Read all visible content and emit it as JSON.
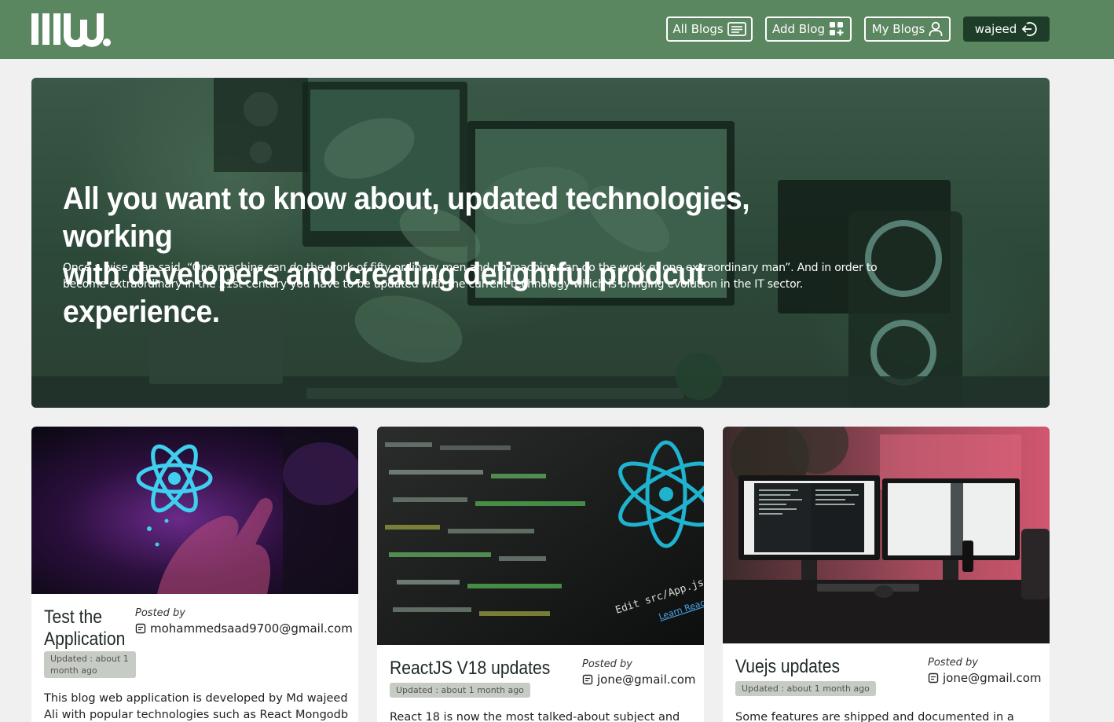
{
  "header": {
    "nav": {
      "all_blogs": "All Blogs",
      "add_blog": "Add Blog",
      "my_blogs": "My Blogs",
      "user": "wajeed"
    }
  },
  "hero": {
    "title_line1": "All you want to know about, updated technologies, working",
    "title_line2": "with developers and creating delightful prodcut experience.",
    "text": "Once a wise man said, “One machine can do the work of fifty ordinary men and no machine can do the work of one extraordinary man”. And in order to become extraordinary in the 21st century you have to be updated with the current technology which is bringing evolution in the IT sector."
  },
  "cards": [
    {
      "title_line1": "Test the",
      "title_line2": "Application",
      "posted_label": "Posted by",
      "email": "mohammedsaad9700@gmail.com",
      "updated_line1": "Updated : about 1",
      "updated_line2": "month ago",
      "desc": "This blog web application is developed by Md wajeed Ali with popular technologies such as React Mongodb"
    },
    {
      "title": "ReactJS V18 updates",
      "posted_label": "Posted by",
      "email": "jone@gmail.com",
      "updated": "Updated : about 1 month ago",
      "desc": "React 18 is now the most talked-about subject and",
      "image_text_1": "Edit src/App.js and save to",
      "image_text_2": "Learn React"
    },
    {
      "title": "Vuejs updates",
      "posted_label": "Posted by",
      "email": "jone@gmail.com",
      "updated": "Updated : about 1 month ago",
      "desc": "Some features are shipped and documented in a"
    }
  ],
  "colors": {
    "header_bg": "#5a8660",
    "user_button_bg": "#1e3d28",
    "page_bg": "#f0f0f1",
    "badge_bg": "#c6cbc3",
    "react_cyan": "#3fd0f0"
  },
  "icons": {
    "all_blogs": "list-icon",
    "add_blog": "grid-plus-icon",
    "my_blogs": "user-icon",
    "user": "logout-icon",
    "posted": "note-icon"
  }
}
